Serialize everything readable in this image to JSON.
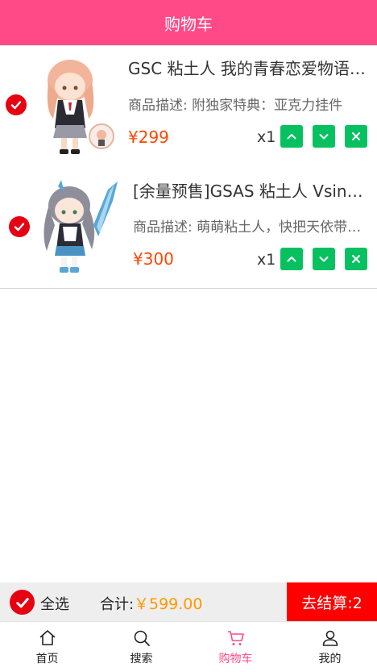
{
  "header": {
    "title": "购物车"
  },
  "items": [
    {
      "title": "GSC 粘土人 我的青春恋爱物语果然有问题",
      "desc": "商品描述: 附独家特典：亚克力挂件",
      "price": "¥299",
      "qty": "x1",
      "checked": true
    },
    {
      "title": "[余量预售]GSAS 粘土人 Vsinger 洛天依",
      "desc": "商品描述: 萌萌粘土人，快把天依带回家",
      "price": "¥300",
      "qty": "x1",
      "checked": true
    }
  ],
  "footer": {
    "select_all_label": "全选",
    "total_label": "合计:",
    "total_value": "￥599.00",
    "checkout_label": "去结算:2"
  },
  "tabbar": {
    "tabs": [
      {
        "label": "首页",
        "icon": "home-icon"
      },
      {
        "label": "搜索",
        "icon": "search-icon"
      },
      {
        "label": "购物车",
        "icon": "cart-icon"
      },
      {
        "label": "我的",
        "icon": "user-icon"
      }
    ],
    "active_tab": "购物车"
  },
  "colors": {
    "header": "#ff4a87",
    "checked": "#e60012",
    "price": "#ff4500",
    "qty_button": "#07c160",
    "total": "#ff9800",
    "checkout": "#ff0000"
  }
}
